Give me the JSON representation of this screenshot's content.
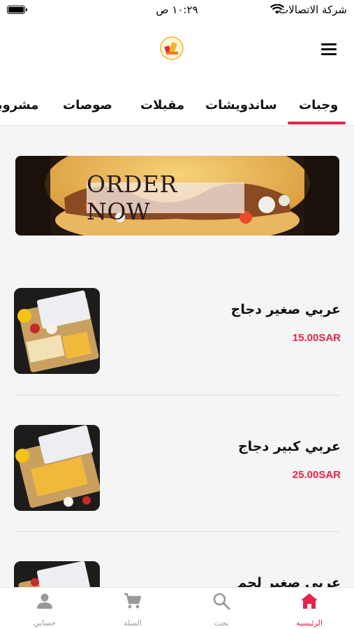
{
  "status_bar": {
    "carrier": "شركة الاتصالات",
    "time": "١٠:٢٩ ص"
  },
  "header": {
    "logo_icon": "restaurant-logo-icon",
    "menu_icon": "hamburger-menu-icon"
  },
  "tabs": [
    {
      "label": "وجبات",
      "active": true
    },
    {
      "label": "ساندويشات",
      "active": false
    },
    {
      "label": "مقبلات",
      "active": false
    },
    {
      "label": "صوصات",
      "active": false
    },
    {
      "label": "مشروبات",
      "active": false
    }
  ],
  "banner": {
    "text": "ORDER NOW"
  },
  "products": [
    {
      "name": "عربي صغير دجاج",
      "price": "15.00SAR"
    },
    {
      "name": "عربي كبير دجاج",
      "price": "25.00SAR"
    },
    {
      "name": "عربي صغير لحم",
      "price": ""
    }
  ],
  "bottom_nav": [
    {
      "label": "الرئيسية",
      "icon": "home-icon",
      "active": true
    },
    {
      "label": "بحث",
      "icon": "search-icon",
      "active": false
    },
    {
      "label": "السلة",
      "icon": "cart-icon",
      "active": false
    },
    {
      "label": "حسابي",
      "icon": "user-icon",
      "active": false
    }
  ],
  "colors": {
    "accent": "#e8224a",
    "inactive": "#999999"
  }
}
